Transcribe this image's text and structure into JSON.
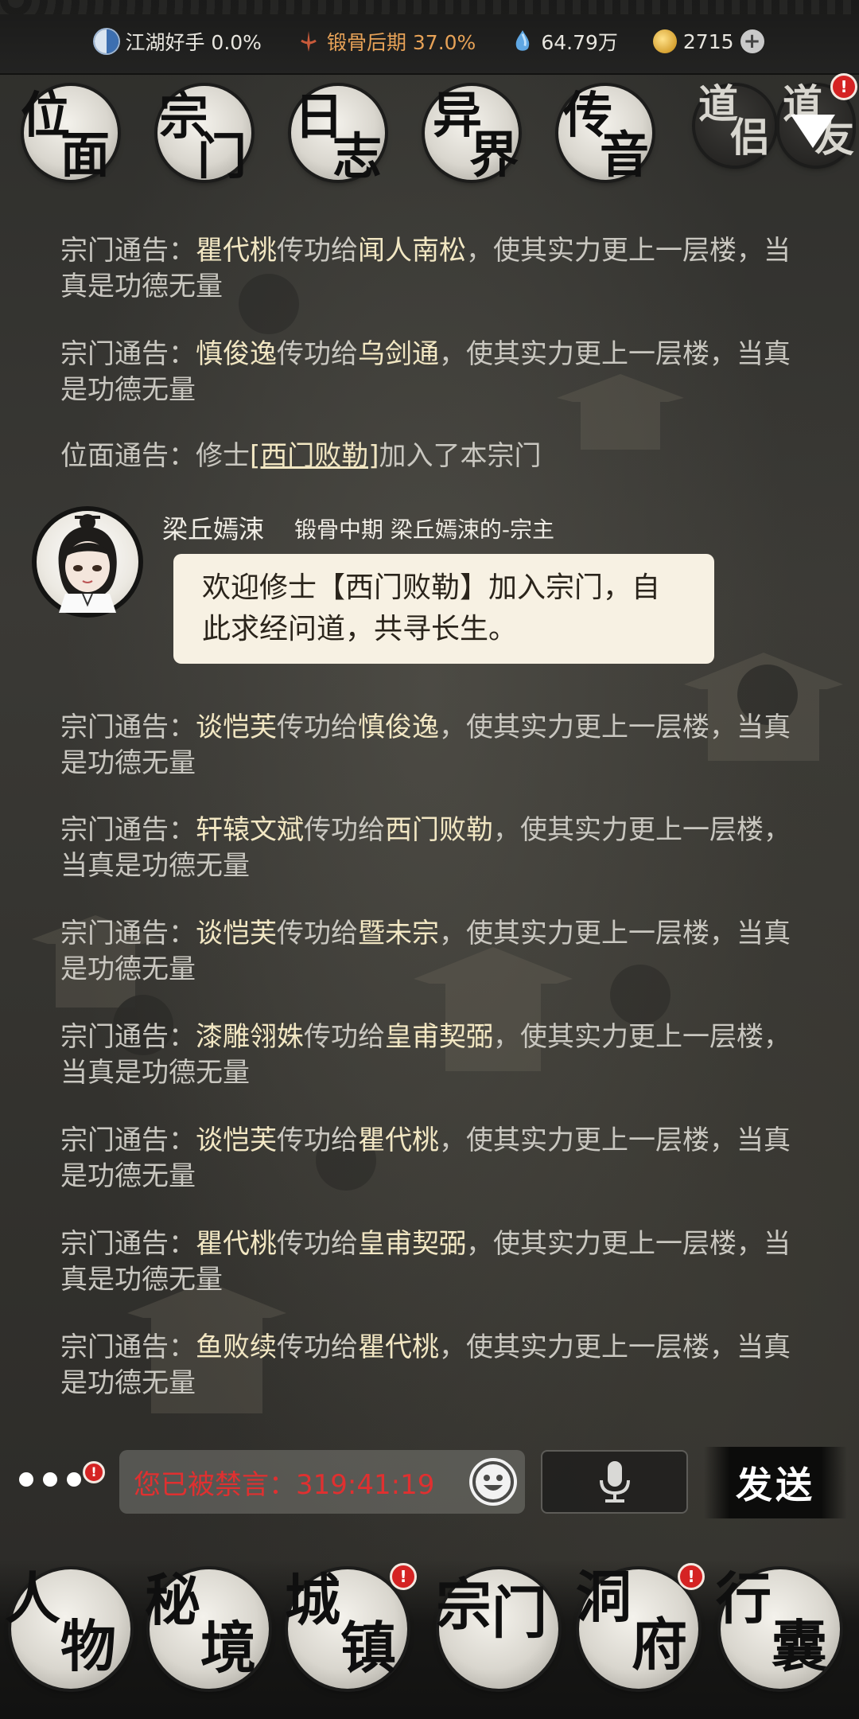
{
  "topbar": {
    "stats": [
      {
        "icon": "yin-yang-icon",
        "text": "江湖好手 0.0%"
      },
      {
        "icon": "sword-rank-icon",
        "text": "锻骨后期 37.0%"
      },
      {
        "icon": "spirit-crystal-icon",
        "text": "64.79万"
      },
      {
        "icon": "gold-coin-icon",
        "text": "2715"
      }
    ],
    "plus_label": "+"
  },
  "nav": {
    "tabs": [
      {
        "c1": "位",
        "c2": "面"
      },
      {
        "c1": "宗",
        "c2": "门"
      },
      {
        "c1": "日",
        "c2": "志"
      },
      {
        "c1": "异",
        "c2": "界"
      },
      {
        "c1": "传",
        "c2": "音"
      },
      {
        "c1": "道",
        "c2": "侣"
      },
      {
        "c1": "道",
        "c2": "友"
      }
    ],
    "badge": "!"
  },
  "messages": [
    {
      "prefix": "宗门通告：",
      "a": "瞿代桃",
      "mid": "传功给",
      "b": "闻人南松",
      "suffix": "，使其实力更上一层楼，当真是功德无量"
    },
    {
      "prefix": "宗门通告：",
      "a": "慎俊逸",
      "mid": "传功给",
      "b": "乌剑通",
      "suffix": "，使其实力更上一层楼，当真是功德无量"
    },
    {
      "prefix": "位面通告：修士",
      "link": "[西门败勒]",
      "suffix": "加入了本宗门"
    }
  ],
  "chat": {
    "name": "梁丘嫣涑",
    "meta": "锻骨中期 梁丘嫣涑的-宗主",
    "text": "欢迎修士【西门败勒】加入宗门，自此求经问道，共寻长生。"
  },
  "messages2": [
    {
      "prefix": "宗门通告：",
      "a": "谈恺芙",
      "mid": "传功给",
      "b": "慎俊逸",
      "suffix": "，使其实力更上一层楼，当真是功德无量"
    },
    {
      "prefix": "宗门通告：",
      "a": "轩辕文斌",
      "mid": "传功给",
      "b": "西门败勒",
      "suffix": "，使其实力更上一层楼，当真是功德无量"
    },
    {
      "prefix": "宗门通告：",
      "a": "谈恺芙",
      "mid": "传功给",
      "b": "暨未宗",
      "suffix": "，使其实力更上一层楼，当真是功德无量"
    },
    {
      "prefix": "宗门通告：",
      "a": "漆雕翎姝",
      "mid": "传功给",
      "b": "皇甫契弼",
      "suffix": "，使其实力更上一层楼，当真是功德无量"
    },
    {
      "prefix": "宗门通告：",
      "a": "谈恺芙",
      "mid": "传功给",
      "b": "瞿代桃",
      "suffix": "，使其实力更上一层楼，当真是功德无量"
    },
    {
      "prefix": "宗门通告：",
      "a": "瞿代桃",
      "mid": "传功给",
      "b": "皇甫契弼",
      "suffix": "，使其实力更上一层楼，当真是功德无量"
    },
    {
      "prefix": "宗门通告：",
      "a": "鱼败续",
      "mid": "传功给",
      "b": "瞿代桃",
      "suffix": "，使其实力更上一层楼，当真是功德无量"
    }
  ],
  "input": {
    "value": "您已被禁言：319:41:19"
  },
  "send_label": "发送",
  "bottom_nav": [
    {
      "c1": "人",
      "c2": "物"
    },
    {
      "c1": "秘",
      "c2": "境"
    },
    {
      "c1": "城",
      "c2": "镇"
    },
    {
      "c1": "宗",
      "c2": "门"
    },
    {
      "c1": "洞",
      "c2": "府"
    },
    {
      "c1": "行",
      "c2": "囊"
    }
  ],
  "colors": {
    "highlight": "#f2e7c3",
    "text": "#c9c7c0",
    "alert": "#d52323",
    "mute_text": "#e03030"
  }
}
